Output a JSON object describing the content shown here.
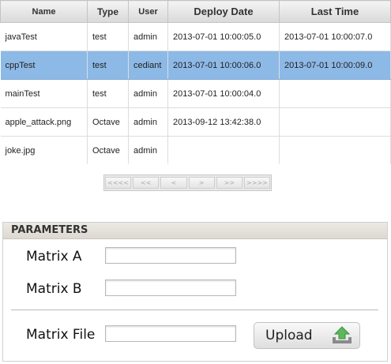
{
  "table": {
    "columns": [
      "Name",
      "Type",
      "User",
      "Deploy Date",
      "Last Time"
    ],
    "rows": [
      {
        "name": "javaTest",
        "type": "test",
        "user": "admin",
        "deploy_date": "2013-07-01 10:00:05.0",
        "last_time": "2013-07-01 10:00:07.0"
      },
      {
        "name": "cppTest",
        "type": "test",
        "user": "cediant",
        "deploy_date": "2013-07-01 10:00:06.0",
        "last_time": "2013-07-01 10:00:09.0"
      },
      {
        "name": "mainTest",
        "type": "test",
        "user": "admin",
        "deploy_date": "2013-07-01 10:00:04.0",
        "last_time": ""
      },
      {
        "name": "apple_attack.png",
        "type": "Octave",
        "user": "admin",
        "deploy_date": "2013-09-12 13:42:38.0",
        "last_time": ""
      },
      {
        "name": "joke.jpg",
        "type": "Octave",
        "user": "admin",
        "deploy_date": "",
        "last_time": ""
      }
    ],
    "selected_row": "cppTest"
  },
  "pager": {
    "first": "<<<<",
    "prev_fast": "<<",
    "prev": "<",
    "next": ">",
    "next_fast": ">>",
    "last": ">>>>"
  },
  "parameters": {
    "title": "PARAMETERS",
    "matrix_a_label": "Matrix A",
    "matrix_a_value": "",
    "matrix_b_label": "Matrix B",
    "matrix_b_value": "",
    "matrix_file_label": "Matrix File",
    "matrix_file_value": "",
    "upload_label": "Upload",
    "upload_icon": "upload-arrow-icon",
    "upload_icon_color": "#5cb85c"
  }
}
